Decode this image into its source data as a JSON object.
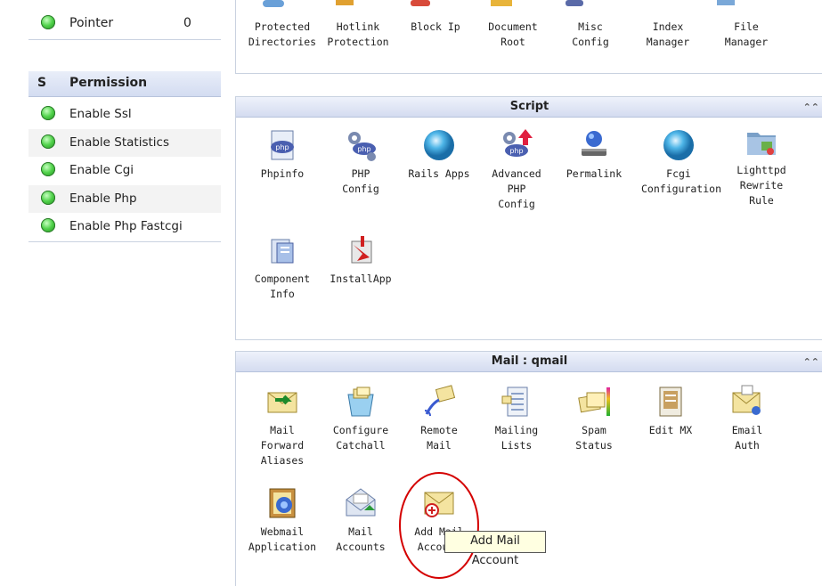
{
  "left": {
    "pointer": {
      "label": "Pointer",
      "value": "0"
    },
    "permission_header": {
      "s": "S",
      "title": "Permission"
    },
    "permissions": [
      {
        "label": "Enable Ssl",
        "icon": "status-green-icon"
      },
      {
        "label": "Enable Statistics",
        "icon": "status-green-icon"
      },
      {
        "label": "Enable Cgi",
        "icon": "status-green-icon"
      },
      {
        "label": "Enable Php",
        "icon": "status-green-icon"
      },
      {
        "label": "Enable Php Fastcgi",
        "icon": "status-green-icon"
      }
    ]
  },
  "top_row": [
    {
      "label": "Protected\nDirectories"
    },
    {
      "label": "Hotlink\nProtection"
    },
    {
      "label": "Block Ip"
    },
    {
      "label": "Document\nRoot"
    },
    {
      "label": "Misc\nConfig"
    },
    {
      "label": "Index\nManager"
    },
    {
      "label": "File\nManager"
    }
  ],
  "script_panel": {
    "title": "Script",
    "collapse_icon": "collapse-icon",
    "items": [
      {
        "label": "Phpinfo",
        "icon": "php-file-icon"
      },
      {
        "label": "PHP\nConfig",
        "icon": "php-config-icon"
      },
      {
        "label": "Rails Apps",
        "icon": "blue-orb-icon"
      },
      {
        "label": "Advanced\nPHP\nConfig",
        "icon": "advanced-php-icon"
      },
      {
        "label": "Permalink",
        "icon": "permalink-icon"
      },
      {
        "label": "Fcgi\nConfiguration",
        "icon": "blue-orb-icon"
      },
      {
        "label": "Lighttpd\nRewrite\nRule",
        "icon": "folder-rewrite-icon"
      },
      {
        "label": "Component\nInfo",
        "icon": "component-info-icon"
      },
      {
        "label": "InstallApp",
        "icon": "install-app-icon"
      }
    ]
  },
  "mail_panel": {
    "title": "Mail : qmail",
    "collapse_icon": "collapse-icon",
    "items": [
      {
        "label": "Mail\nForward\nAliases",
        "icon": "mail-forward-icon"
      },
      {
        "label": "Configure\nCatchall",
        "icon": "catchall-icon"
      },
      {
        "label": "Remote\nMail",
        "icon": "remote-mail-icon"
      },
      {
        "label": "Mailing\nLists",
        "icon": "mailing-list-icon"
      },
      {
        "label": "Spam\nStatus",
        "icon": "spam-icon"
      },
      {
        "label": "Edit MX",
        "icon": "edit-mx-icon"
      },
      {
        "label": "Email\nAuth",
        "icon": "email-auth-icon"
      },
      {
        "label": "Webmail\nApplication",
        "icon": "webmail-icon"
      },
      {
        "label": "Mail\nAccounts",
        "icon": "mail-accounts-icon"
      },
      {
        "label": "Add Mail\nAccount",
        "icon": "add-mail-icon"
      }
    ]
  },
  "tooltip": {
    "text": "Add Mail Account"
  },
  "colors": {
    "header_bg": "#d4dcf0",
    "border": "#c9d2e0",
    "tooltip_bg": "#ffffe1",
    "highlight": "#d40000"
  }
}
